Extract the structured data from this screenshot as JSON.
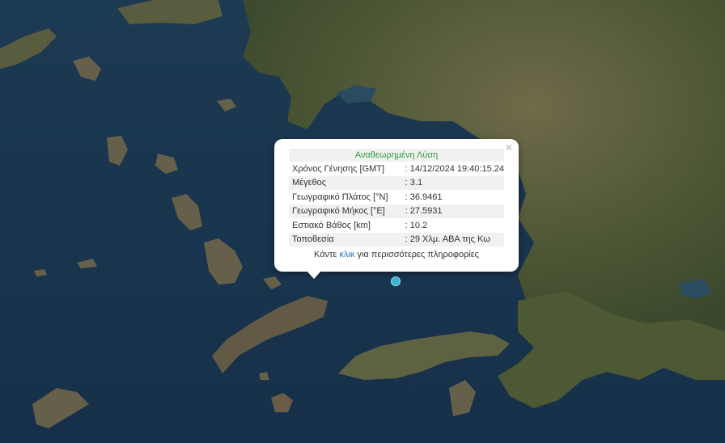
{
  "popup": {
    "title": "Αναθεωρημένη Λύση",
    "close_icon": "×",
    "rows": [
      {
        "label": "Χρόνος Γένησης [GMT]",
        "value": ": 14/12/2024 19:40:15.24"
      },
      {
        "label": "Μέγεθος",
        "value": ": 3.1"
      },
      {
        "label": "Γεωγραφικό Πλάτος [°N]",
        "value": ": 36.9461"
      },
      {
        "label": "Γεωγραφικό Μήκος [°E]",
        "value": ": 27.5931"
      },
      {
        "label": "Εστιακό Βάθος [km]",
        "value": ": 10.2"
      },
      {
        "label": "Τοποθεσία",
        "value": ": 29 Χλμ. ΑΒΑ της Κω"
      }
    ],
    "more_prefix": "Κάντε ",
    "more_link": "κλικ",
    "more_suffix": " για περισσότερες πληροφορίες"
  },
  "colors": {
    "sea": "#1a3247",
    "land_dark": "#3d4a2c",
    "land_mid": "#5b6140",
    "land_light": "#7f7556",
    "marker": "#3fb3d6",
    "title_green": "#2e9e3a",
    "link_blue": "#1a73c9"
  },
  "marker": {
    "icon": "earthquake-epicenter-icon"
  }
}
